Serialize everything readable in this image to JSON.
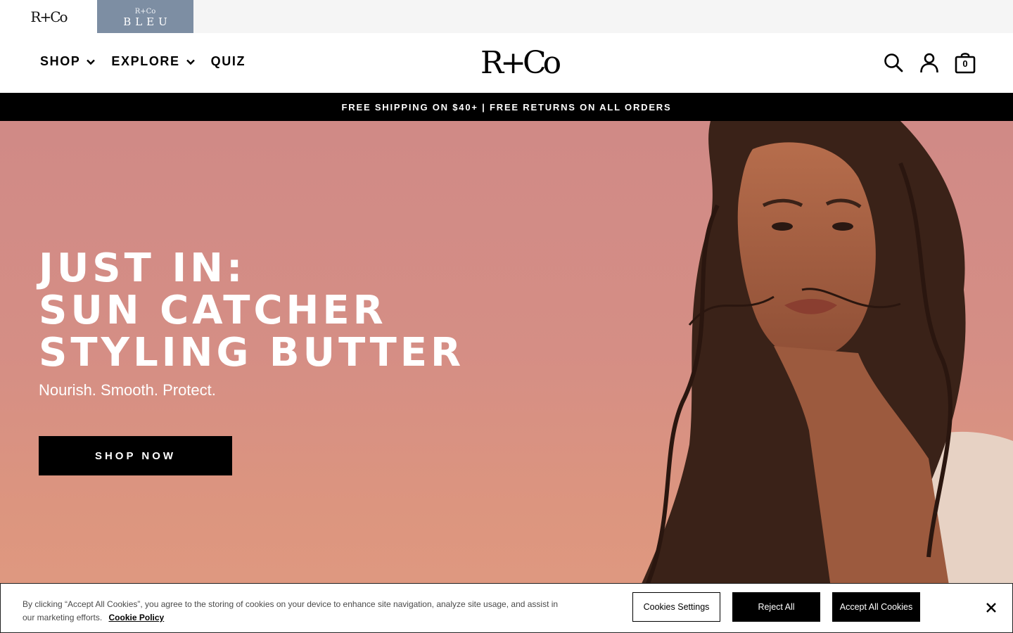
{
  "brand_switcher": {
    "rco_label": "R+Co",
    "bleu_mark": "R+Co",
    "bleu_label": "BLEU"
  },
  "header": {
    "logo": "R+Co",
    "nav": [
      {
        "label": "SHOP",
        "has_dropdown": true
      },
      {
        "label": "EXPLORE",
        "has_dropdown": true
      },
      {
        "label": "QUIZ",
        "has_dropdown": false
      }
    ],
    "icons": [
      "search-icon",
      "account-icon",
      "cart-icon"
    ],
    "cart_count": "0"
  },
  "announcement": "FREE SHIPPING ON $40+ | FREE RETURNS ON ALL ORDERS",
  "hero": {
    "title_lines": [
      "JUST IN:",
      "SUN CATCHER",
      "STYLING BUTTER"
    ],
    "subtitle": "Nourish. Smooth. Protect.",
    "cta": "SHOP NOW",
    "background_color": "#d58e85"
  },
  "cookie_banner": {
    "text": "By clicking “Accept All Cookies”, you agree to the storing of cookies on your device to enhance site navigation, analyze site usage, and assist in our marketing efforts.",
    "policy_link": "Cookie Policy",
    "settings_button": "Cookies Settings",
    "reject_button": "Reject All",
    "accept_button": "Accept All Cookies"
  }
}
